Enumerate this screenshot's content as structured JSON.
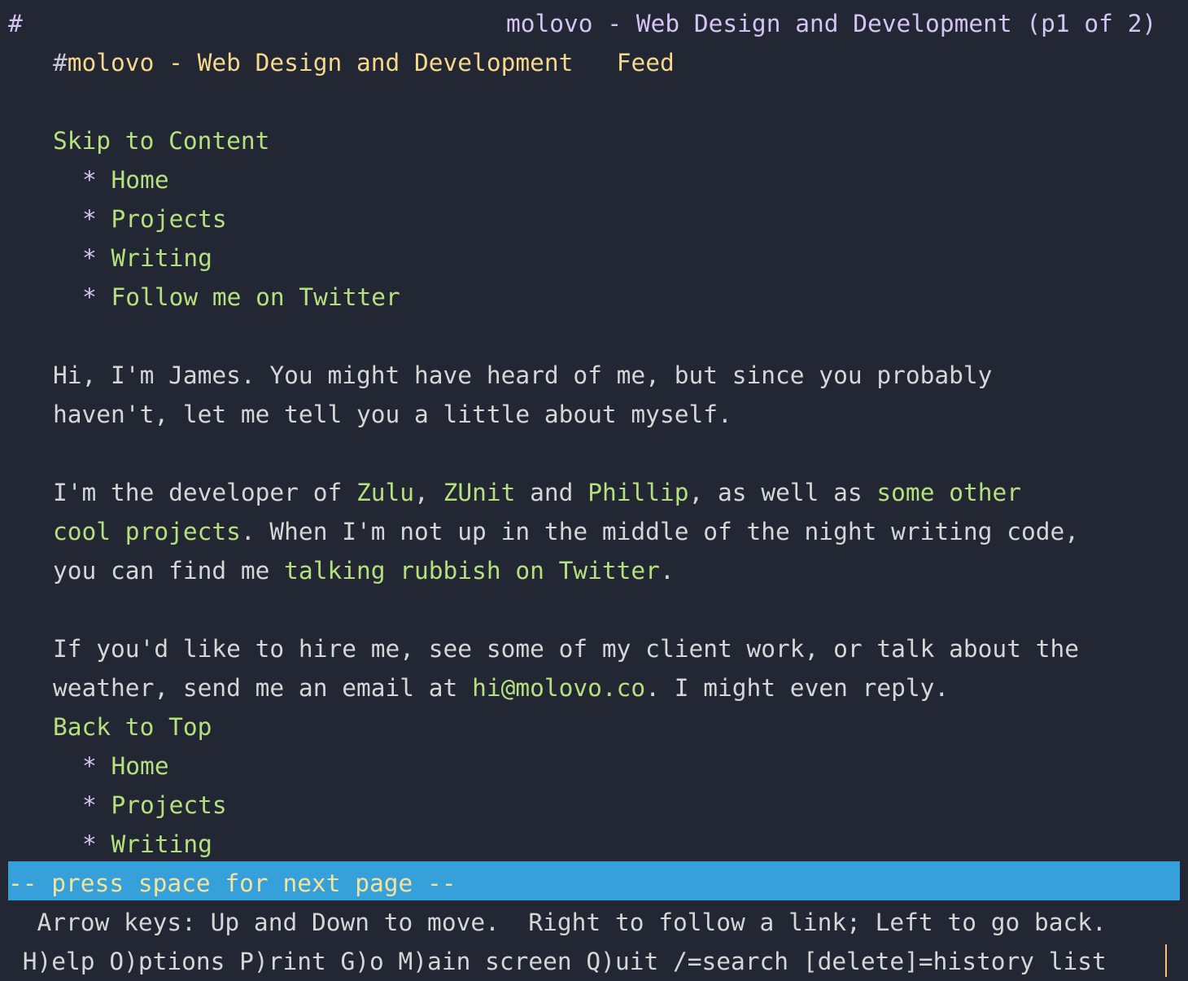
{
  "title_bar": {
    "marker": "#",
    "title": "molovo - Web Design and Development (p1 of 2)"
  },
  "header": {
    "hash": "#",
    "site_name": "molovo - Web Design and Development",
    "feed_link": "Feed"
  },
  "skip_link": "Skip to Content",
  "nav_top": {
    "bullet": "*",
    "items": [
      "Home",
      "Projects",
      "Writing",
      "Follow me on Twitter"
    ]
  },
  "intro": {
    "line1": "Hi, I'm James. You might have heard of me, but since you probably",
    "line2": "haven't, let me tell you a little about myself."
  },
  "para2": {
    "t1": "I'm the developer of ",
    "link_zulu": "Zulu",
    "t2": ", ",
    "link_zunit": "ZUnit",
    "t3": " and ",
    "link_phillip": "Phillip",
    "t4": ", as well as ",
    "link_other_a": "some other",
    "link_other_b": "cool projects",
    "t5": ". When I'm not up in the middle of the night writing code,",
    "t6": "you can find me ",
    "link_twitter": "talking rubbish on Twitter",
    "t7": "."
  },
  "para3": {
    "line1": "If you'd like to hire me, see some of my client work, or talk about the",
    "t1": "weather, send me an email at ",
    "link_email": "hi@molovo.co",
    "t2": ". I might even reply."
  },
  "back_to_top": "Back to Top",
  "nav_bottom": {
    "bullet": "*",
    "items": [
      "Home",
      "Projects",
      "Writing"
    ]
  },
  "status": {
    "prompt": "-- press space for next page --",
    "help_line1": "  Arrow keys: Up and Down to move.  Right to follow a link; Left to go back.",
    "help_line2": " H)elp O)ptions P)rint G)o M)ain screen Q)uit /=search [delete]=history list"
  },
  "colors": {
    "background": "#222733",
    "link": "#b5e07e",
    "heading": "#f5d88b",
    "title": "#d4c4f4",
    "status_bar": "#35a0da"
  }
}
